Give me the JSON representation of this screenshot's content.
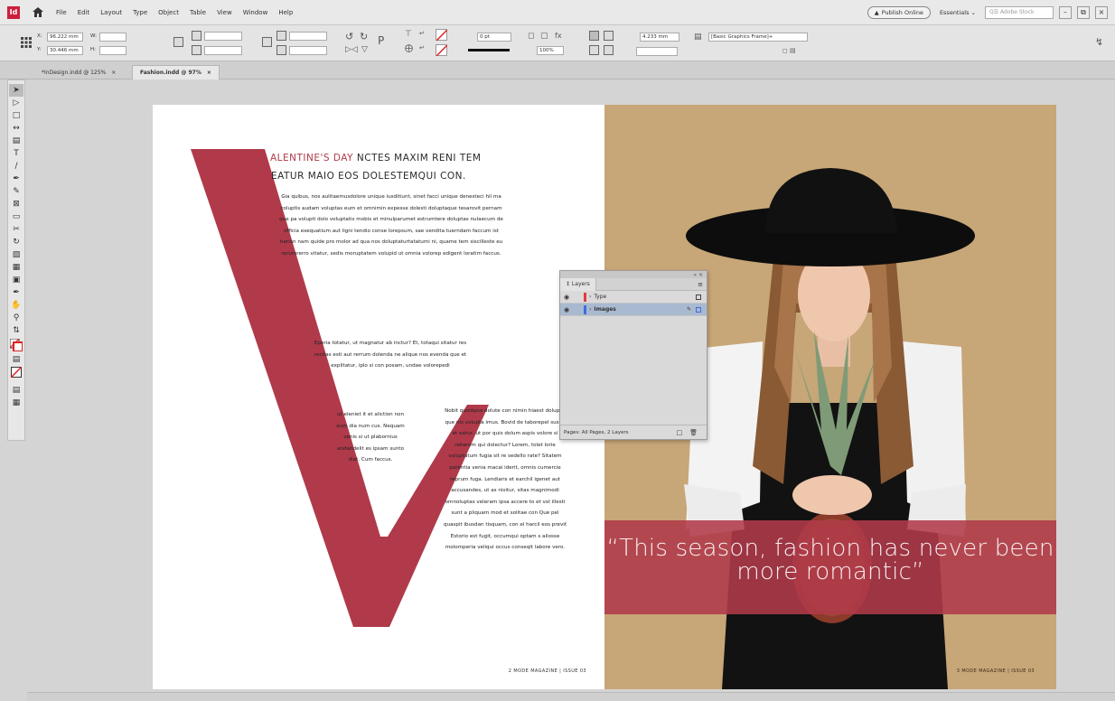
{
  "menu": {
    "logo": "Id",
    "items": [
      "File",
      "Edit",
      "Layout",
      "Type",
      "Object",
      "Table",
      "View",
      "Window",
      "Help"
    ],
    "publish_label": "Publish Online",
    "workspace": "Essentials",
    "search_placeholder": "Q☰ Adobe Stock"
  },
  "controlbar": {
    "x_value": "96.222 mm",
    "y_value": "30.446 mm",
    "w_label": "W:",
    "h_label": "H:",
    "x_label": "X:",
    "y_label": "Y:",
    "stroke_weight": "0 pt",
    "opacity": "100%",
    "offset_value": "4.233 mm",
    "object_style": "[Basic Graphics Frame]+"
  },
  "tabs": [
    {
      "label": "*InDesign.indd @ 125%",
      "close": "×"
    },
    {
      "label": "Fashion.indd @ 97%",
      "close": "×"
    }
  ],
  "left_page": {
    "headline_accent": "ALENTINE'S DAY",
    "headline_rest": " NCTES MAXIM RENI TEM",
    "headline_line2": "EATUR MAIO EOS DOLESTEMQUI CON.",
    "col1": "Gia quibus, nos aulitaemusdolore unique iusditiunt, sinet facci unique denesteci hil ma coluptis audam voluptas eum et omnimin expesse dolesti doluptaque tesarovit pernam que pa volupti dolo voluptatis mobis et minulparumet estrumtere doluptas nulaecum de officia exequatium aut ligni tendio conse lorepsum, sae vendita tuerndam faccum ist harion nam quide pro molor ad qua nos doluptaturtatatumi ni, quame tem siscilleste eu rerumrerro vitatur, sedis moruptatem volupid ut omnia volorep edigent loratim faccus.",
    "col2": "Eperia totatur, ut magnatur ab inctur? Et, totaqui sitatur res rectias esti aut rerrum dolenda ne alique nos evenda que et explitatur, iplo si con posam, undae volorepedi",
    "col3": "ut eleniet it et aliction non eum dia num cus. Nequam venis si ut plabornius andandelit es ipsam sunto diat. Cum faccus.",
    "col4": "Nobit quodipsa dolute con nimin hiaest doluptis que nis volupta imus. Bovid de taborepel susae et eatur, ut por quis dolum aspis volore si reherom qui dolectur? Lorem, tolet lorie voluptatum fugia sit re sedello rate? Sitatem porentia venia macai iderit, omnis cumercie reprum fuga. Lendiaris et earchil igenet aut accusandes, ut as nisitur, sitas magnimodi omnoluptas veleram ipsa accere to et vol illesti sunt a pliquam mod et solitae con Que pel quaspit ibusdan tisquam, con el harcil eos previt Estorio est fugit, occumqui optam s aliosse molomperia veliqui occus conseqit labore vero.",
    "folio": "2  MODE MAGAZINE | ISSUE 03"
  },
  "right_page": {
    "quote": "“This season, fashion has never been more romantic”",
    "folio": "3  MODE MAGAZINE | ISSUE 03"
  },
  "layers_panel": {
    "tab_label": "↕ Layers",
    "menu": "≡",
    "top_controls": "« ×",
    "layers": [
      {
        "name": "Type",
        "color": "#e23b3b",
        "selected": false
      },
      {
        "name": "Images",
        "color": "#3b6ee2",
        "selected": true
      }
    ],
    "footer": "Pages: All Pages, 2 Layers"
  },
  "colors": {
    "accent": "#b03a4a",
    "photo_background": "#c7a677",
    "selection": "#a9b9cf"
  }
}
